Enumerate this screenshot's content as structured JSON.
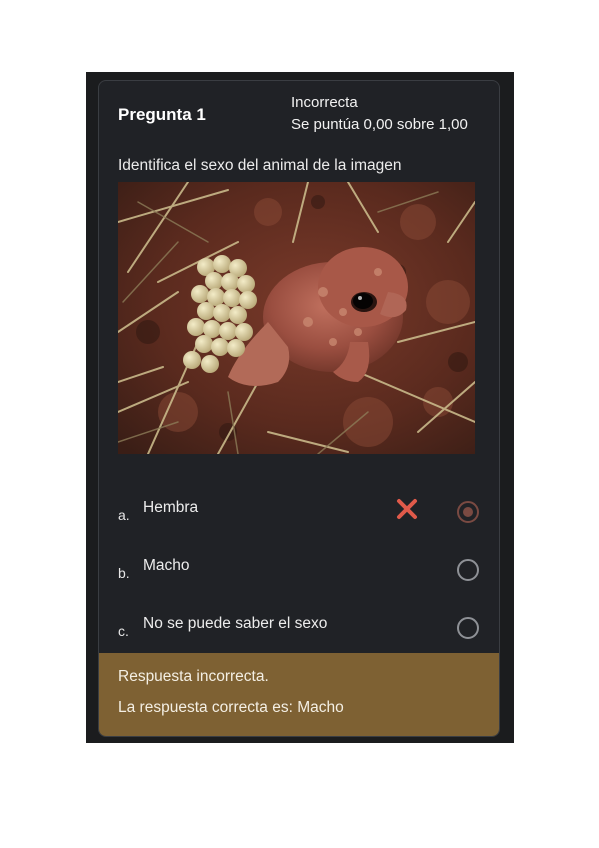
{
  "question": {
    "title": "Pregunta 1",
    "status": "Incorrecta",
    "grade": "Se puntúa 0,00 sobre 1,00",
    "text": "Identifica el sexo del animal de la imagen"
  },
  "options": [
    {
      "letter": "a.",
      "label": "Hembra",
      "selected": true,
      "marked_wrong": true
    },
    {
      "letter": "b.",
      "label": "Macho",
      "selected": false,
      "marked_wrong": false
    },
    {
      "letter": "c.",
      "label": "No se puede saber el sexo",
      "selected": false,
      "marked_wrong": false
    }
  ],
  "feedback": {
    "result": "Respuesta incorrecta.",
    "correct": "La respuesta correcta es: Macho"
  },
  "colors": {
    "card_bg": "#202226",
    "feedback_bg": "#7e6133",
    "wrong_mark": "#e05a4a",
    "selected_radio": "#7a4a42"
  },
  "icons": {
    "wrong": "close-icon",
    "radio": "radio-icon"
  }
}
